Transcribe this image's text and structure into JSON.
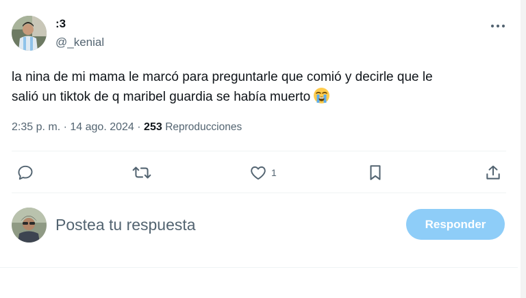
{
  "author": {
    "display_name": ":3",
    "handle": "@_kenial",
    "avatar_icon": "profile-photo-avatar"
  },
  "tweet": {
    "line1": "la nina de mi mama le marcó para preguntarle que comió y decirle que le",
    "line2": "salió un tiktok de q maribel guardia se había muerto",
    "emoji": "loudly-crying-face-emoji"
  },
  "meta": {
    "time": "2:35 p. m.",
    "separator": "·",
    "date": "14 ago. 2024",
    "views_count": "253",
    "views_label": "Reproducciones"
  },
  "actions": {
    "reply_icon": "reply-icon",
    "retweet_icon": "retweet-icon",
    "like_icon": "heart-icon",
    "like_count": "1",
    "bookmark_icon": "bookmark-icon",
    "share_icon": "share-icon",
    "more_icon": "more-dots-icon"
  },
  "reply_box": {
    "placeholder": "Postea tu respuesta",
    "button_label": "Responder",
    "avatar_icon": "profile-photo-avatar"
  },
  "colors": {
    "text_primary": "#0f1419",
    "text_secondary": "#536471",
    "button_disabled": "#8ecdf8",
    "divider": "#eff3f4"
  }
}
